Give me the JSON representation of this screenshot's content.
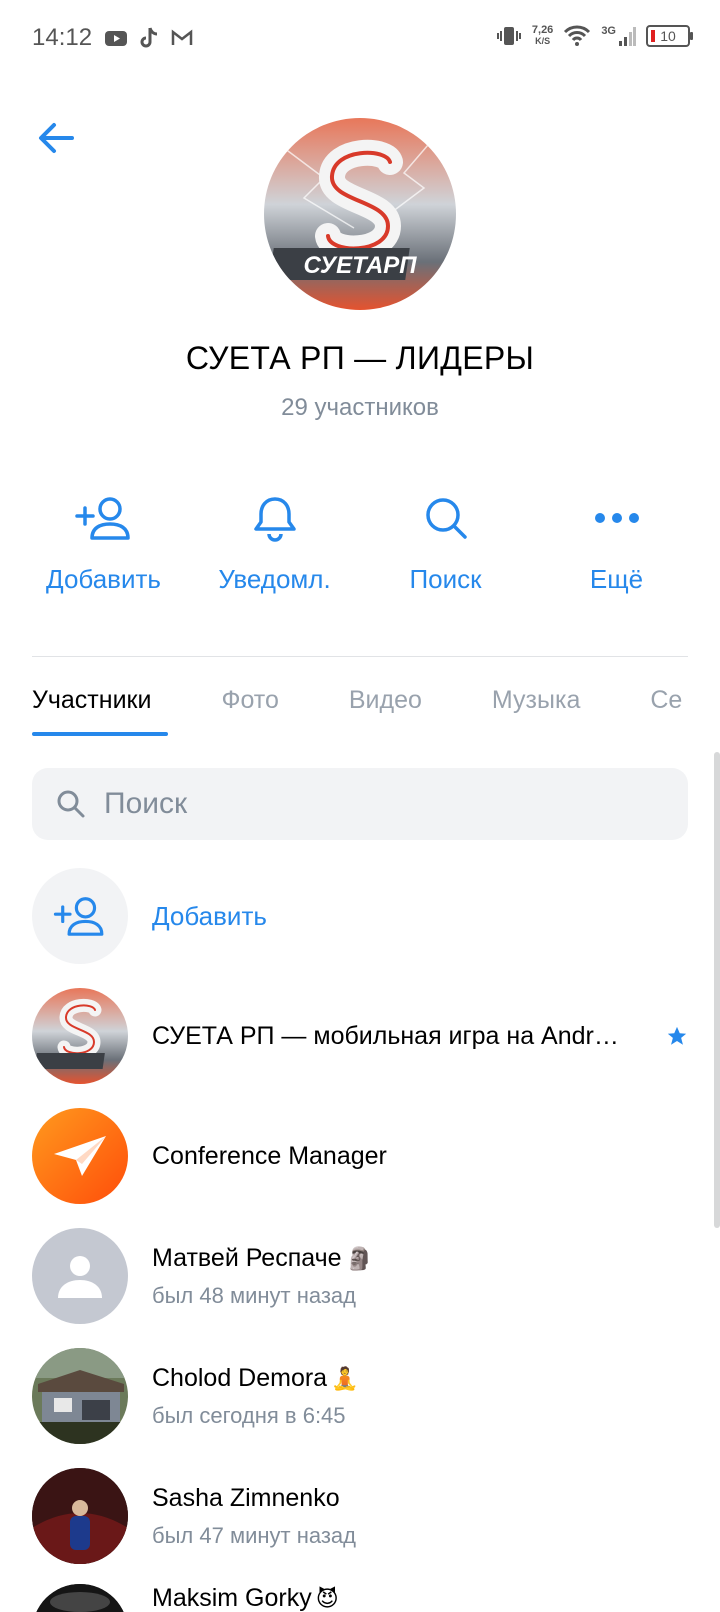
{
  "status_bar": {
    "time": "14:12",
    "speed_value": "7,26",
    "speed_unit": "K/S",
    "network": "3G",
    "battery": "10"
  },
  "group": {
    "avatar_text": "СУЕТАРП",
    "title": "СУЕТА РП — ЛИДЕРЫ",
    "subtitle": "29 участников"
  },
  "actions": [
    {
      "label": "Добавить",
      "icon": "add-user-icon"
    },
    {
      "label": "Уведомл.",
      "icon": "bell-icon"
    },
    {
      "label": "Поиск",
      "icon": "search-icon"
    },
    {
      "label": "Ещё",
      "icon": "more-icon"
    }
  ],
  "tabs": [
    "Участники",
    "Фото",
    "Видео",
    "Музыка",
    "Се"
  ],
  "search": {
    "placeholder": "Поиск"
  },
  "members": {
    "add_label": "Добавить",
    "items": [
      {
        "name": "СУЕТА РП — мобильная игра на Andr…",
        "status": "",
        "avatar": "logo",
        "badge": "star-icon"
      },
      {
        "name": "Conference Manager",
        "status": "",
        "avatar": "paper-plane"
      },
      {
        "name": "Матвей Респаче",
        "status": "был 48 минут назад",
        "avatar": "placeholder",
        "emoji": "🗿"
      },
      {
        "name": "Cholod Demora",
        "status": "был сегодня в 6:45",
        "avatar": "photo-building",
        "emoji": "🧘"
      },
      {
        "name": "Sasha Zimnenko",
        "status": "был 47 минут назад",
        "avatar": "photo-dark"
      },
      {
        "name": "Maksim Gorky",
        "status": "",
        "avatar": "photo-dark",
        "emoji": "😈"
      }
    ]
  },
  "colors": {
    "accent": "#2688eb",
    "secondary_text": "#818c99",
    "tab_inactive": "#99a2ad",
    "search_bg": "#f2f3f5"
  }
}
